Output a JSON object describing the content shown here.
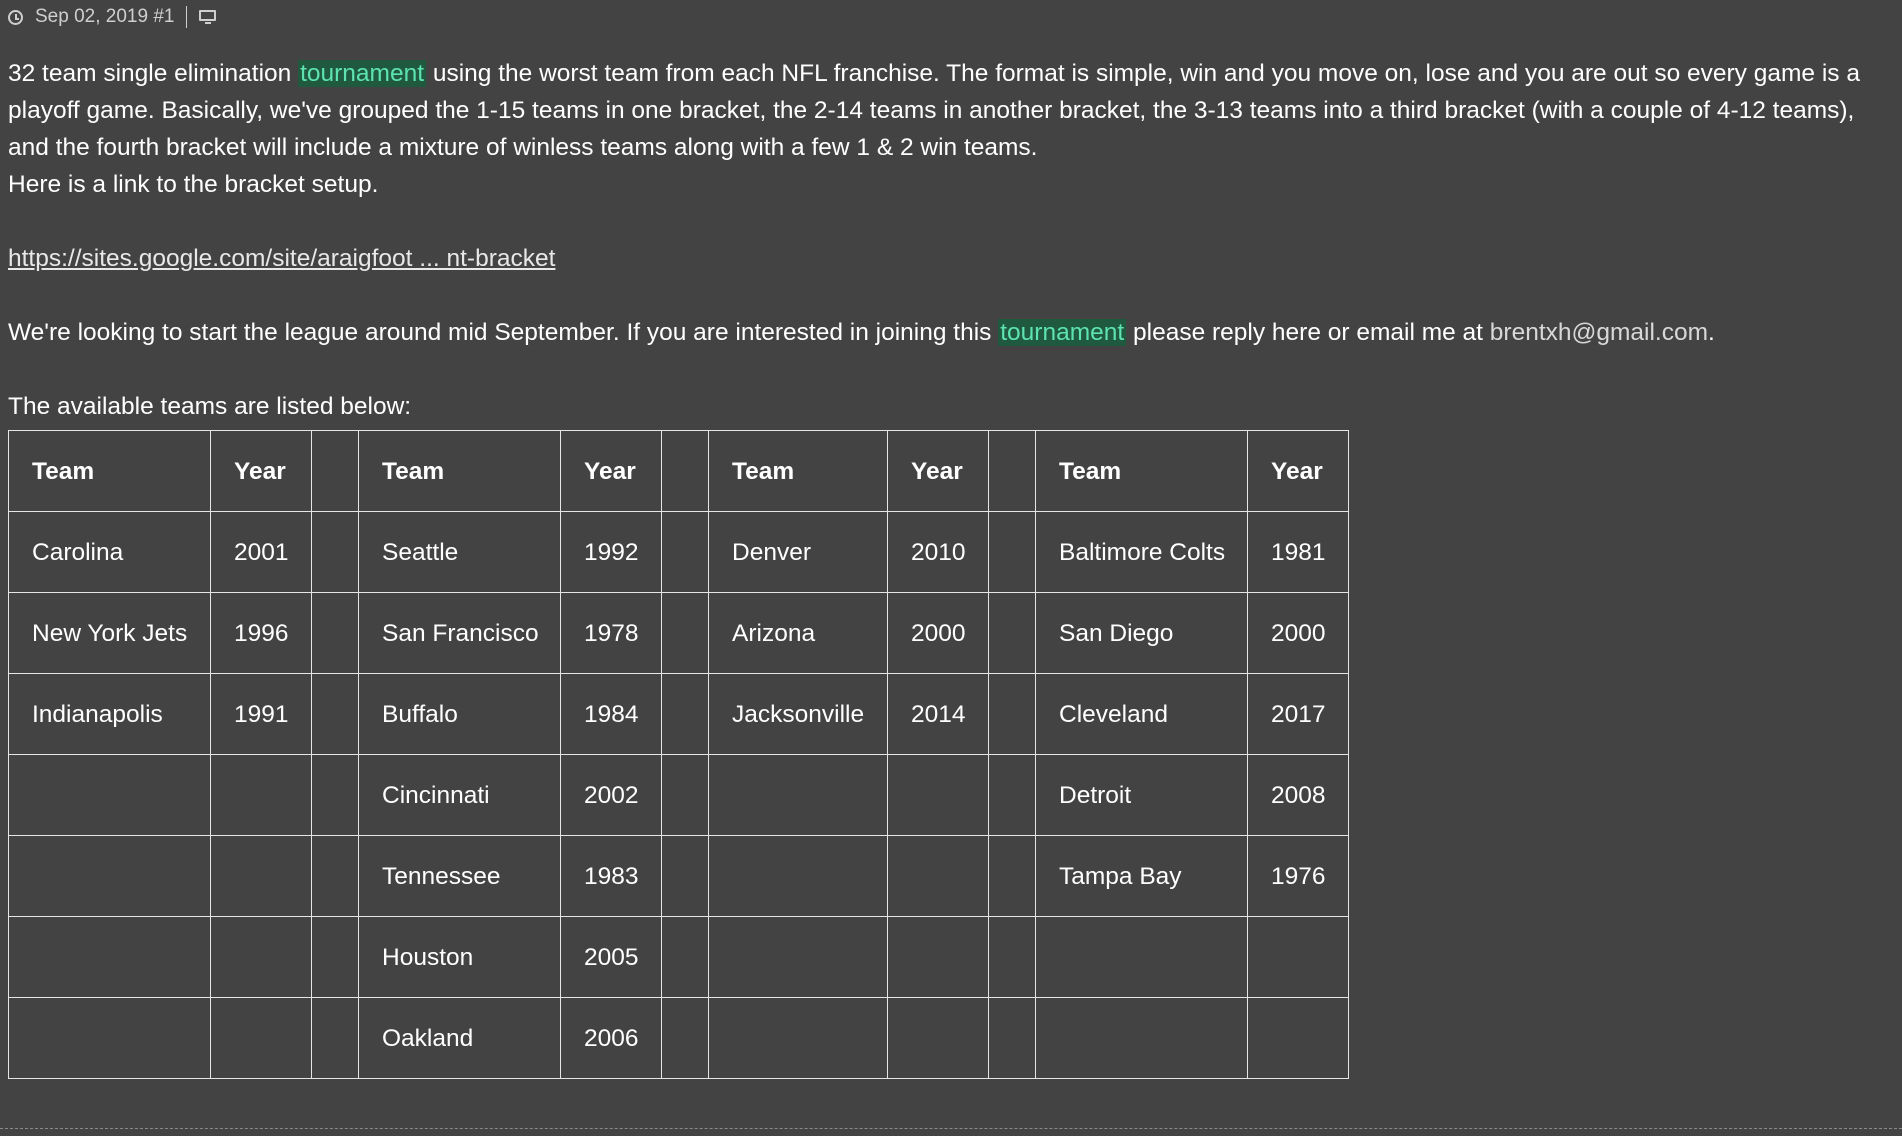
{
  "post": {
    "date": "Sep 02, 2019",
    "post_number": "#1",
    "icons": [
      "clock-icon",
      "monitor-icon"
    ]
  },
  "content": {
    "p1_a": "32 team single elimination ",
    "p1_hl": "tournament",
    "p1_b": " using the worst team from each NFL franchise.  The format is simple, win and you move on, lose and you are out so every game is a playoff game.  Basically, we've grouped the 1-15 teams in one bracket, the 2-14 teams in another bracket, the 3-13 teams into a third bracket (with a couple of 4-12 teams), and the fourth bracket will include a mixture of winless teams along with a few 1 & 2 win teams.",
    "p2": "Here is a link to the bracket setup.",
    "link": "https://sites.google.com/site/araigfoot ... nt-bracket",
    "p3_a": "We're looking to start the league around mid September.  If you are interested in joining this ",
    "p3_hl": "tournament",
    "p3_b": " please reply here or email me at ",
    "email": "brentxh@gmail.com",
    "p3_c": ".",
    "p4": "The available teams are listed below:"
  },
  "table": {
    "headers": [
      "Team",
      "Year",
      "",
      "Team",
      "Year",
      "",
      "Team",
      "Year",
      "",
      "Team",
      "Year"
    ],
    "rows": [
      [
        "Carolina",
        "2001",
        "",
        "Seattle",
        "1992",
        "",
        "Denver",
        "2010",
        "",
        "Baltimore Colts",
        "1981"
      ],
      [
        "New York Jets",
        "1996",
        "",
        "San Francisco",
        "1978",
        "",
        "Arizona",
        "2000",
        "",
        "San Diego",
        "2000"
      ],
      [
        "Indianapolis",
        "1991",
        "",
        "Buffalo",
        "1984",
        "",
        "Jacksonville",
        "2014",
        "",
        "Cleveland",
        "2017"
      ],
      [
        "",
        "",
        "",
        "Cincinnati",
        "2002",
        "",
        "",
        "",
        "",
        "Detroit",
        "2008"
      ],
      [
        "",
        "",
        "",
        "Tennessee",
        "1983",
        "",
        "",
        "",
        "",
        "Tampa Bay",
        "1976"
      ],
      [
        "",
        "",
        "",
        "Houston",
        "2005",
        "",
        "",
        "",
        "",
        "",
        ""
      ],
      [
        "",
        "",
        "",
        "Oakland",
        "2006",
        "",
        "",
        "",
        "",
        "",
        ""
      ]
    ]
  }
}
